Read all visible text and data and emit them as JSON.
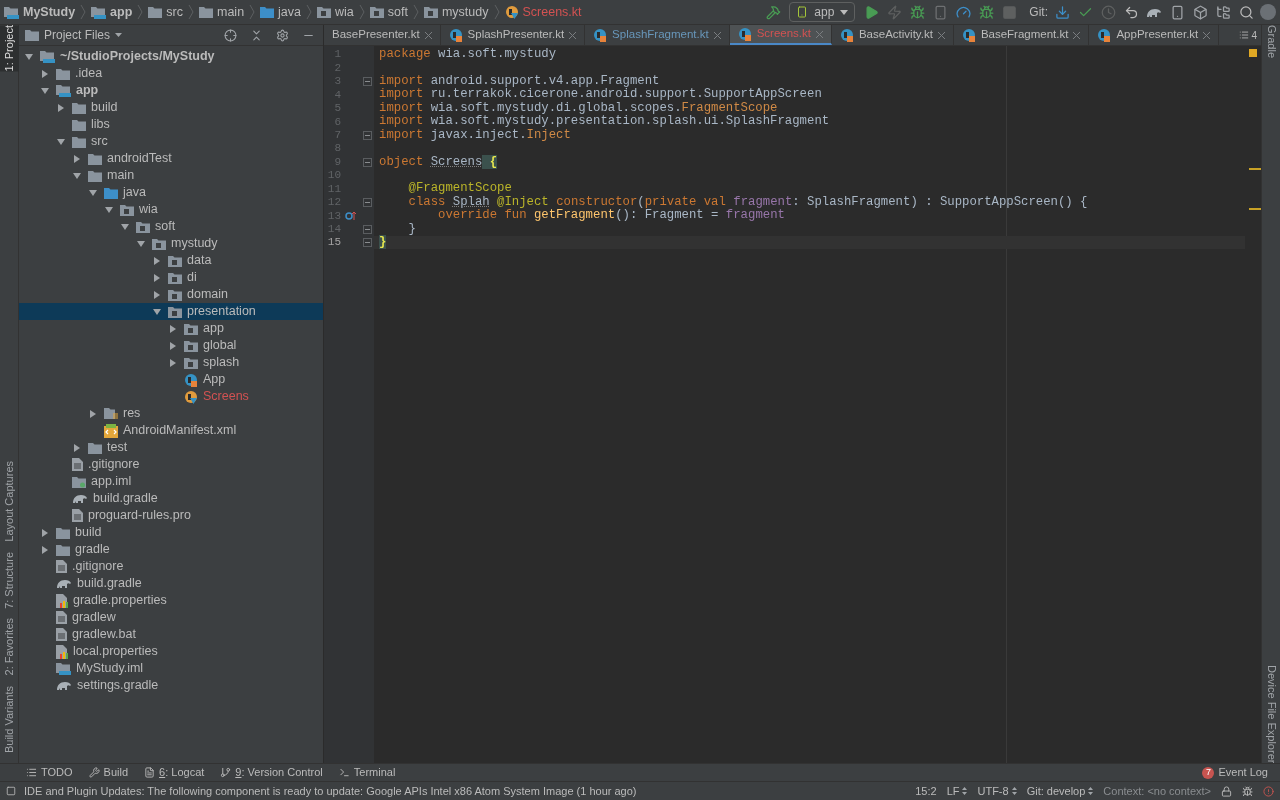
{
  "breadcrumb": [
    {
      "label": "MyStudy",
      "kind": "module"
    },
    {
      "label": "app",
      "kind": "module"
    },
    {
      "label": "src",
      "kind": "folder"
    },
    {
      "label": "main",
      "kind": "folder"
    },
    {
      "label": "java",
      "kind": "source"
    },
    {
      "label": "wia",
      "kind": "package"
    },
    {
      "label": "soft",
      "kind": "package"
    },
    {
      "label": "mystudy",
      "kind": "package"
    },
    {
      "label": "Screens.kt",
      "kind": "kotlin"
    }
  ],
  "toolbar": {
    "run_config": "app",
    "git_label": "Git:"
  },
  "left_strip": [
    {
      "label": "1: Project",
      "selected": true
    },
    {
      "label": "Layout Captures",
      "selected": false
    },
    {
      "label": "7: Structure",
      "selected": false
    },
    {
      "label": "2: Favorites",
      "selected": false
    },
    {
      "label": "Build Variants",
      "selected": false
    }
  ],
  "right_strip": [
    {
      "label": "Gradle"
    },
    {
      "label": "Device File Explorer"
    }
  ],
  "project_panel": {
    "title": "Project Files",
    "tree": [
      {
        "label": "~/StudioProjects/MyStudy",
        "kind": "module",
        "expanded": true,
        "selected": false,
        "error": false,
        "children": [
          {
            "label": ".idea",
            "kind": "folder",
            "expanded": false,
            "selected": false,
            "error": false
          },
          {
            "label": "app",
            "kind": "module",
            "expanded": true,
            "selected": false,
            "error": false,
            "children": [
              {
                "label": "build",
                "kind": "folder",
                "expanded": false,
                "selected": false,
                "error": false
              },
              {
                "label": "libs",
                "kind": "folder",
                "selected": false,
                "error": false
              },
              {
                "label": "src",
                "kind": "folder",
                "expanded": true,
                "selected": false,
                "error": false,
                "children": [
                  {
                    "label": "androidTest",
                    "kind": "folder",
                    "expanded": false,
                    "selected": false,
                    "error": false
                  },
                  {
                    "label": "main",
                    "kind": "folder",
                    "expanded": true,
                    "selected": false,
                    "error": false,
                    "children": [
                      {
                        "label": "java",
                        "kind": "source",
                        "expanded": true,
                        "selected": false,
                        "error": false,
                        "children": [
                          {
                            "label": "wia",
                            "kind": "package",
                            "expanded": true,
                            "selected": false,
                            "error": false,
                            "children": [
                              {
                                "label": "soft",
                                "kind": "package",
                                "expanded": true,
                                "selected": false,
                                "error": false,
                                "children": [
                                  {
                                    "label": "mystudy",
                                    "kind": "package",
                                    "expanded": true,
                                    "selected": false,
                                    "error": false,
                                    "children": [
                                      {
                                        "label": "data",
                                        "kind": "package",
                                        "expanded": false,
                                        "selected": false,
                                        "error": false
                                      },
                                      {
                                        "label": "di",
                                        "kind": "package",
                                        "expanded": false,
                                        "selected": false,
                                        "error": false
                                      },
                                      {
                                        "label": "domain",
                                        "kind": "package",
                                        "expanded": false,
                                        "selected": false,
                                        "error": false
                                      },
                                      {
                                        "label": "presentation",
                                        "kind": "package",
                                        "expanded": true,
                                        "selected": true,
                                        "error": false,
                                        "children": [
                                          {
                                            "label": "app",
                                            "kind": "package",
                                            "expanded": false,
                                            "selected": false,
                                            "error": false
                                          },
                                          {
                                            "label": "global",
                                            "kind": "package",
                                            "expanded": false,
                                            "selected": false,
                                            "error": false
                                          },
                                          {
                                            "label": "splash",
                                            "kind": "package",
                                            "expanded": false,
                                            "selected": false,
                                            "error": false
                                          },
                                          {
                                            "label": "App",
                                            "kind": "kotlin",
                                            "selected": false,
                                            "error": false
                                          },
                                          {
                                            "label": "Screens",
                                            "kind": "kotlin",
                                            "selected": false,
                                            "error": true
                                          }
                                        ]
                                      }
                                    ]
                                  }
                                ]
                              }
                            ]
                          }
                        ]
                      },
                      {
                        "label": "res",
                        "kind": "res",
                        "expanded": false,
                        "selected": false,
                        "error": false
                      },
                      {
                        "label": "AndroidManifest.xml",
                        "kind": "xml",
                        "selected": false,
                        "error": false
                      }
                    ]
                  },
                  {
                    "label": "test",
                    "kind": "folder",
                    "expanded": false,
                    "selected": false,
                    "error": false
                  }
                ]
              },
              {
                "label": ".gitignore",
                "kind": "file",
                "selected": false,
                "error": false
              },
              {
                "label": "app.iml",
                "kind": "iml",
                "selected": false,
                "error": false
              },
              {
                "label": "build.gradle",
                "kind": "gradle",
                "selected": false,
                "error": false
              },
              {
                "label": "proguard-rules.pro",
                "kind": "file",
                "selected": false,
                "error": false
              }
            ]
          },
          {
            "label": "build",
            "kind": "folder",
            "expanded": false,
            "selected": false,
            "error": false
          },
          {
            "label": "gradle",
            "kind": "folder",
            "expanded": false,
            "selected": false,
            "error": false
          },
          {
            "label": ".gitignore",
            "kind": "file",
            "selected": false,
            "error": false
          },
          {
            "label": "build.gradle",
            "kind": "gradle",
            "selected": false,
            "error": false
          },
          {
            "label": "gradle.properties",
            "kind": "properties",
            "selected": false,
            "error": false
          },
          {
            "label": "gradlew",
            "kind": "file",
            "selected": false,
            "error": false
          },
          {
            "label": "gradlew.bat",
            "kind": "file",
            "selected": false,
            "error": false
          },
          {
            "label": "local.properties",
            "kind": "properties",
            "selected": false,
            "error": false
          },
          {
            "label": "MyStudy.iml",
            "kind": "iml-module",
            "selected": false,
            "error": false
          },
          {
            "label": "settings.gradle",
            "kind": "gradle",
            "selected": false,
            "error": false
          }
        ]
      }
    ]
  },
  "tabs": [
    {
      "label": "BasePresenter.kt",
      "kind": "plain",
      "selected": false,
      "color": "#bbbbbb"
    },
    {
      "label": "SplashPresenter.kt",
      "kind": "kotlin",
      "selected": false,
      "color": "#bbbbbb"
    },
    {
      "label": "SplashFragment.kt",
      "kind": "kotlin",
      "selected": false,
      "color": "#6897bb"
    },
    {
      "label": "Screens.kt",
      "kind": "kotlin",
      "selected": true,
      "color": "#d25252"
    },
    {
      "label": "BaseActivity.kt",
      "kind": "kotlin",
      "selected": false,
      "color": "#bbbbbb"
    },
    {
      "label": "BaseFragment.kt",
      "kind": "kotlin",
      "selected": false,
      "color": "#bbbbbb"
    },
    {
      "label": "AppPresenter.kt",
      "kind": "kotlin",
      "selected": false,
      "color": "#bbbbbb"
    }
  ],
  "tab_overflow": "4",
  "editor": {
    "lines": [
      {
        "number": "1",
        "kind": "plain",
        "current": false,
        "tokens": [
          {
            "kind": "kw",
            "text": "package "
          },
          {
            "kind": "plain",
            "text": "wia.soft.mystudy"
          }
        ]
      },
      {
        "number": "2",
        "kind": "plain",
        "current": false
      },
      {
        "number": "3",
        "kind": "fold",
        "current": false,
        "tokens": [
          {
            "kind": "kw",
            "text": "import "
          },
          {
            "kind": "plain",
            "text": "android.support.v4.app.Fragment"
          }
        ]
      },
      {
        "number": "4",
        "kind": "plain",
        "current": false,
        "tokens": [
          {
            "kind": "kw",
            "text": "import "
          },
          {
            "kind": "plain",
            "text": "ru.terrakok.cicerone.android.support.SupportAppScreen"
          }
        ]
      },
      {
        "number": "5",
        "kind": "plain",
        "current": false,
        "tokens": [
          {
            "kind": "kw",
            "text": "import "
          },
          {
            "kind": "plain",
            "text": "wia.soft.mystudy.di.global.scopes."
          },
          {
            "kind": "ref",
            "text": "FragmentScope"
          }
        ]
      },
      {
        "number": "6",
        "kind": "plain",
        "current": false,
        "tokens": [
          {
            "kind": "kw",
            "text": "import "
          },
          {
            "kind": "plain",
            "text": "wia.soft.mystudy.presentation.splash.ui.SplashFragment"
          }
        ]
      },
      {
        "number": "7",
        "kind": "fold",
        "current": false,
        "tokens": [
          {
            "kind": "kw",
            "text": "import "
          },
          {
            "kind": "plain",
            "text": "javax.inject."
          },
          {
            "kind": "ref",
            "text": "Inject"
          }
        ]
      },
      {
        "number": "8",
        "kind": "plain",
        "current": false
      },
      {
        "number": "9",
        "kind": "fold",
        "current": false,
        "tokens": [
          {
            "kind": "kw",
            "text": "object "
          },
          {
            "kind": "unused",
            "text": "Screens"
          },
          {
            "kind": "match",
            "text": " {"
          }
        ]
      },
      {
        "number": "10",
        "kind": "plain",
        "current": false
      },
      {
        "number": "11",
        "kind": "plain",
        "current": false,
        "tokens": [
          {
            "kind": "annot",
            "text": "    @FragmentScope"
          }
        ]
      },
      {
        "number": "12",
        "kind": "fold",
        "current": false,
        "tokens": [
          {
            "kind": "kw",
            "text": "    class "
          },
          {
            "kind": "unused",
            "text": "Splah"
          },
          {
            "kind": "annot",
            "text": " @Inject"
          },
          {
            "kind": "kw",
            "text": " constructor"
          },
          {
            "kind": "plain",
            "text": "("
          },
          {
            "kind": "kw",
            "text": "private val "
          },
          {
            "kind": "prop",
            "text": "fragment"
          },
          {
            "kind": "plain",
            "text": ": SplashFragment) : SupportAppScreen() {"
          }
        ]
      },
      {
        "number": "13",
        "kind": "override",
        "current": false,
        "tokens": [
          {
            "kind": "kw",
            "text": "        override fun "
          },
          {
            "kind": "fn",
            "text": "getFragment"
          },
          {
            "kind": "plain",
            "text": "(): Fragment = "
          },
          {
            "kind": "prop",
            "text": "fragment"
          }
        ]
      },
      {
        "number": "14",
        "kind": "fold",
        "current": false,
        "tokens": [
          {
            "kind": "plain",
            "text": "    }"
          }
        ]
      },
      {
        "number": "15",
        "kind": "fold",
        "current": true,
        "tokens": [
          {
            "kind": "match",
            "text": "}"
          }
        ]
      }
    ]
  },
  "bottom_tools": [
    {
      "kind": "todo",
      "label": "TODO"
    },
    {
      "kind": "build",
      "label": "Build"
    },
    {
      "kind": "logcat",
      "key": "6",
      "label": ": Logcat"
    },
    {
      "kind": "vcs",
      "key": "9",
      "label": ": Version Control"
    },
    {
      "kind": "terminal",
      "label": "Terminal"
    }
  ],
  "event_log": {
    "label": "Event Log",
    "count": "7"
  },
  "status": {
    "message": "IDE and Plugin Updates: The following component is ready to update: Google APIs Intel x86 Atom System Image (1 hour ago)",
    "position": "15:2",
    "line_separator": "LF",
    "encoding": "UTF-8",
    "branch": "Git: develop",
    "context": "Context: <no context>"
  }
}
